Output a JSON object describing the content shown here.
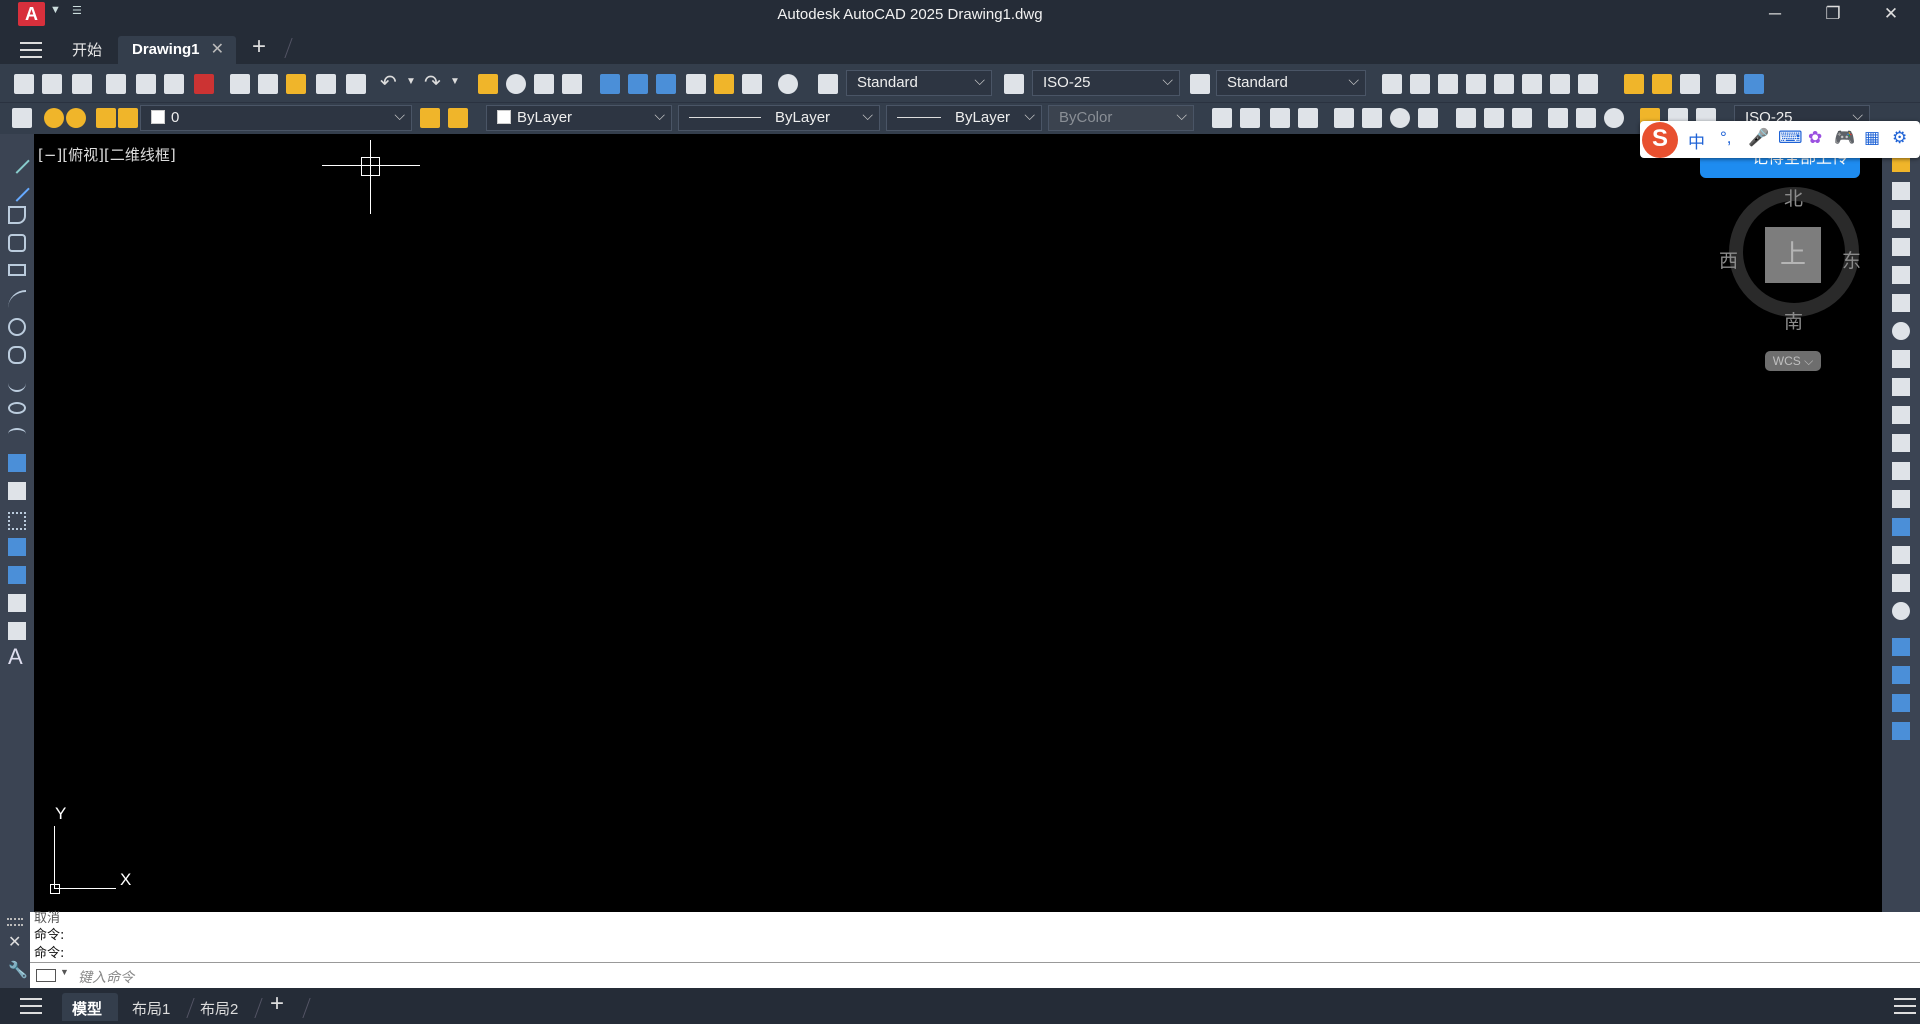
{
  "app": {
    "title": "Autodesk AutoCAD 2025    Drawing1.dwg",
    "logo_letter": "A",
    "window_controls": [
      "─",
      "❐",
      "✕"
    ]
  },
  "doc_tabs": {
    "start": "开始",
    "active": "Drawing1",
    "close": "✕",
    "add": "+"
  },
  "toolbar1": {
    "text_style": "Standard",
    "dim_style": "ISO-25",
    "table_style": "Standard"
  },
  "toolbar2": {
    "layer": "0",
    "color": "ByLayer",
    "linetype": "ByLayer",
    "lineweight": "ByLayer",
    "plotstyle": "ByColor",
    "multileader_style": "ISO-25"
  },
  "viewport": {
    "label": "[−][俯视][二维线框]",
    "background": "#000000"
  },
  "viewcube": {
    "north": "北",
    "south": "南",
    "east": "东",
    "west": "西",
    "face": "上",
    "wcs": "WCS ⌵"
  },
  "ucs": {
    "x": "X",
    "y": "Y"
  },
  "command": {
    "history": [
      "取消",
      "命令:",
      "命令:"
    ],
    "placeholder": "键入命令"
  },
  "layout_tabs": {
    "model": "模型",
    "layout1": "布局1",
    "layout2": "布局2",
    "add": "+"
  },
  "ime": {
    "logo": "S",
    "items": [
      "中",
      "°,",
      "🎤",
      "⌨",
      "✿",
      "🎮",
      "▦",
      "⚙"
    ],
    "banner": "记得全部上传"
  },
  "colors": {
    "titlebar": "#252c37",
    "toolbar": "#343e4c",
    "accent_red": "#d8303c"
  }
}
